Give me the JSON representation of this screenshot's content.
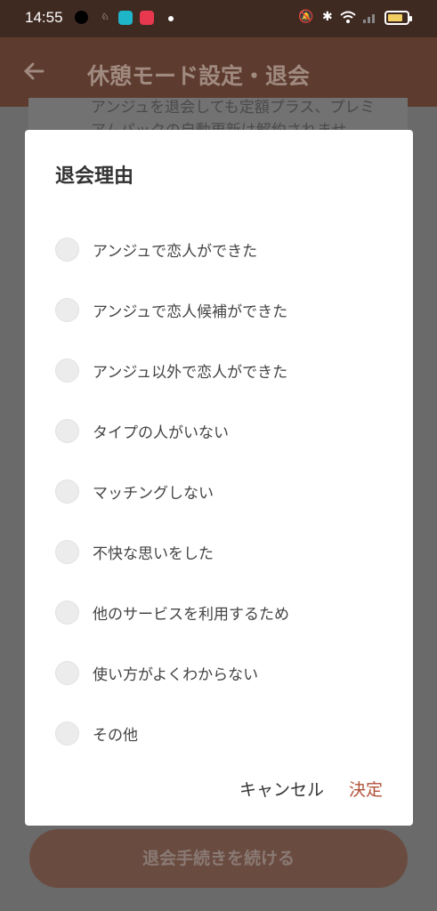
{
  "status_bar": {
    "time": "14:55",
    "icons": [
      "chat-bubble-icon",
      "rabbit-icon",
      "app-icon-cyan",
      "crop-icon-red",
      "dot-icon",
      "mute-icon",
      "bluetooth-icon",
      "wifi-icon",
      "signal-icon",
      "battery-icon"
    ],
    "colors": {
      "app_cyan": "#1fb5c9",
      "app_red": "#e8384f",
      "battery_fill": "#f2cf63"
    }
  },
  "app_bar": {
    "title": "休憩モード設定・退会",
    "back_icon": "arrow-left-icon"
  },
  "page": {
    "note": "アンジュを退会しても定額プラス、プレミアムパックの自動更新は解約されませ",
    "continue_button": "退会手続きを続ける"
  },
  "dialog": {
    "title": "退会理由",
    "options": [
      {
        "label": "アンジュで恋人ができた"
      },
      {
        "label": "アンジュで恋人候補ができた"
      },
      {
        "label": "アンジュ以外で恋人ができた"
      },
      {
        "label": "タイプの人がいない"
      },
      {
        "label": "マッチングしない"
      },
      {
        "label": "不快な思いをした"
      },
      {
        "label": "他のサービスを利用するため"
      },
      {
        "label": "使い方がよくわからない"
      },
      {
        "label": "その他"
      }
    ],
    "cancel_label": "キャンセル",
    "ok_label": "決定",
    "accent_color": "#b0523a"
  }
}
